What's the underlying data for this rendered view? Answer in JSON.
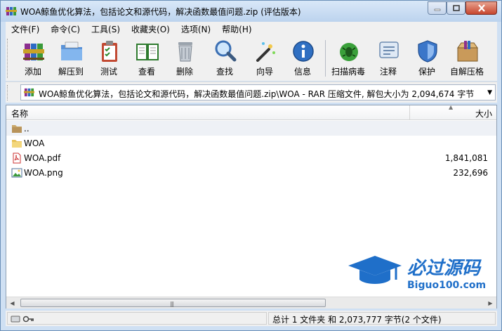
{
  "window": {
    "title": "WOA鲸鱼优化算法，包括论文和源代码，解决函数最值问题.zip (评估版本)"
  },
  "menu": [
    "文件(F)",
    "命令(C)",
    "工具(S)",
    "收藏夹(O)",
    "选项(N)",
    "帮助(H)"
  ],
  "toolbar": {
    "tools": [
      {
        "label": "添加",
        "icon": "add-archive-icon"
      },
      {
        "label": "解压到",
        "icon": "extract-to-icon"
      },
      {
        "label": "测试",
        "icon": "test-icon"
      },
      {
        "label": "查看",
        "icon": "view-book-icon"
      },
      {
        "label": "删除",
        "icon": "trash-icon"
      },
      {
        "label": "查找",
        "icon": "magnifier-icon"
      },
      {
        "label": "向导",
        "icon": "wizard-wand-icon"
      },
      {
        "label": "信息",
        "icon": "info-icon"
      },
      {
        "label": "扫描病毒",
        "icon": "virus-scan-icon"
      },
      {
        "label": "注释",
        "icon": "comment-icon"
      },
      {
        "label": "保护",
        "icon": "shield-icon"
      },
      {
        "label": "自解压格",
        "icon": "sfx-box-icon"
      }
    ]
  },
  "address": {
    "text": "WOA鲸鱼优化算法，包括论文和源代码，解决函数最值问题.zip\\WOA - RAR 压缩文件, 解包大小为 2,094,674 字节"
  },
  "list": {
    "col_name": "名称",
    "col_size": "大小",
    "rows": [
      {
        "name": "..",
        "size": "",
        "icon": "parent-folder-icon"
      },
      {
        "name": "WOA",
        "size": "",
        "icon": "folder-icon"
      },
      {
        "name": "WOA.pdf",
        "size": "1,841,081",
        "icon": "pdf-file-icon"
      },
      {
        "name": "WOA.png",
        "size": "232,696",
        "icon": "image-file-icon"
      }
    ]
  },
  "watermark": {
    "title": "必过源码",
    "url": "Biguo100.com"
  },
  "status": {
    "summary": "总计 1 文件夹 和 2,073,777 字节(2 个文件)"
  }
}
